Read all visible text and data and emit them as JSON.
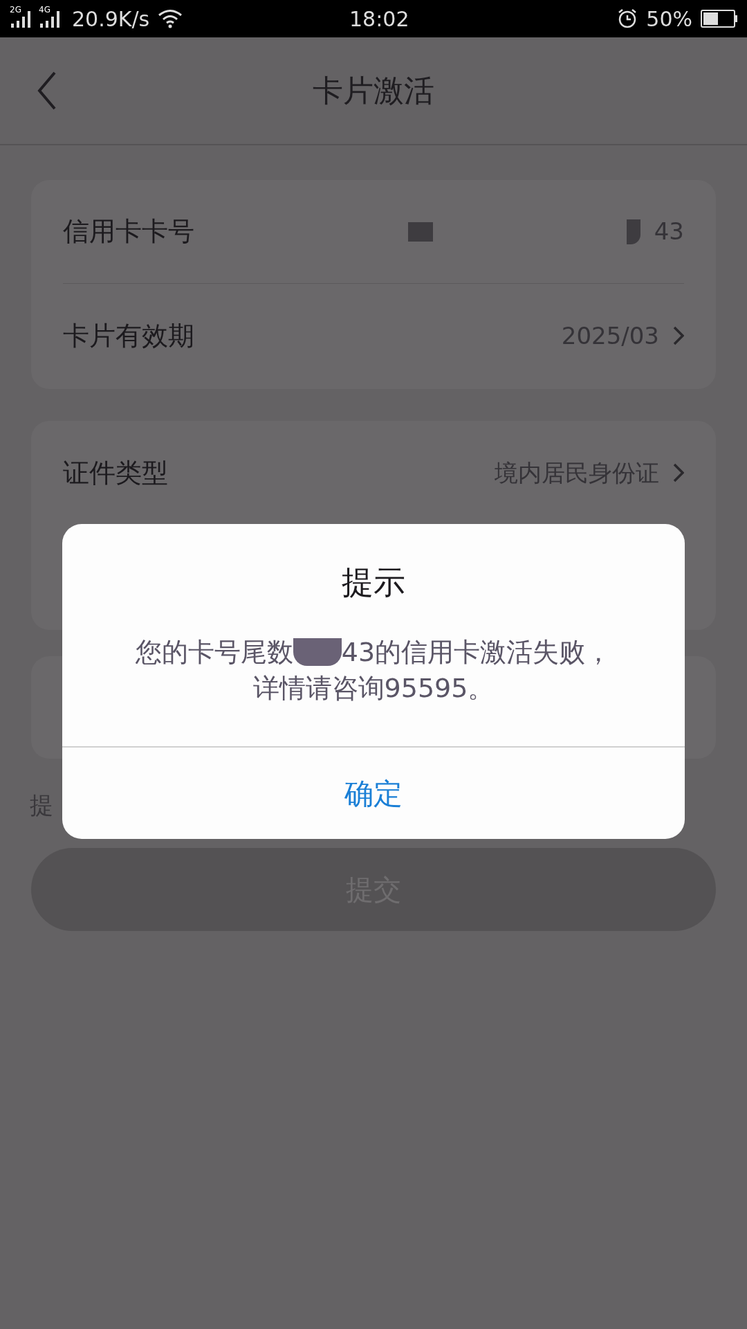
{
  "status_bar": {
    "net_labels": [
      "2G",
      "4G"
    ],
    "speed": "20.9K/s",
    "time": "18:02",
    "battery_text": "50%",
    "battery": {
      "level": 0.5
    }
  },
  "header": {
    "title": "卡片激活"
  },
  "cards": [
    {
      "rows": [
        {
          "label": "信用卡卡号",
          "value": "43",
          "masked": true,
          "chevron": false
        },
        {
          "label": "卡片有效期",
          "value": "2025/03",
          "masked": false,
          "chevron": true
        }
      ]
    },
    {
      "rows": [
        {
          "label": "证件类型",
          "value": "境内居民身份证",
          "masked": false,
          "chevron": true
        }
      ]
    }
  ],
  "hint": "提",
  "submit": {
    "label": "提交",
    "disabled": true
  },
  "dialog": {
    "title": "提示",
    "message_before": "您的卡号尾数",
    "message_after": "43的信用卡激活失败，",
    "message_line2": "详情请咨询95595。",
    "button": "确定"
  }
}
